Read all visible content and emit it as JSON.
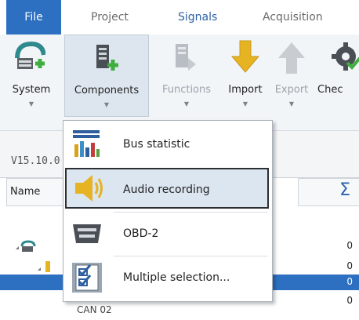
{
  "tabs": [
    {
      "label": "File",
      "active": true
    },
    {
      "label": "Project",
      "active": false
    },
    {
      "label": "Signals",
      "active": false
    },
    {
      "label": "Acquisition",
      "active": false
    }
  ],
  "ribbon": {
    "buttons": [
      {
        "label": "System",
        "enabled": true,
        "has_dropdown": true
      },
      {
        "label": "Components",
        "enabled": true,
        "has_dropdown": true,
        "open": true
      },
      {
        "label": "Functions",
        "enabled": false,
        "has_dropdown": true
      },
      {
        "label": "Import",
        "enabled": true,
        "has_dropdown": true
      },
      {
        "label": "Export",
        "enabled": false,
        "has_dropdown": true
      },
      {
        "label": "Chec",
        "enabled": true,
        "has_dropdown": false
      }
    ]
  },
  "components_menu": {
    "items": [
      {
        "label": "Bus statistic",
        "icon": "bus-statistic-icon"
      },
      {
        "label": "Audio recording",
        "icon": "speaker-icon",
        "hovered": true
      },
      {
        "label": "OBD-2",
        "icon": "obd-connector-icon"
      },
      {
        "label": "Multiple selection...",
        "icon": "multi-select-icon"
      }
    ]
  },
  "version_label": "V15.10.0",
  "grid": {
    "columns": [
      {
        "label": "Name"
      },
      {
        "label": "Σ"
      }
    ],
    "rows": [
      {
        "value": "0"
      },
      {
        "value": "0"
      },
      {
        "value": "0",
        "selected": true
      },
      {
        "value": "0"
      }
    ],
    "partial_label": "CAN 02"
  },
  "colors": {
    "accent": "#2d6fc1",
    "ribbon_bg": "#f2f5f8",
    "menu_hover": "#dce6f0"
  }
}
